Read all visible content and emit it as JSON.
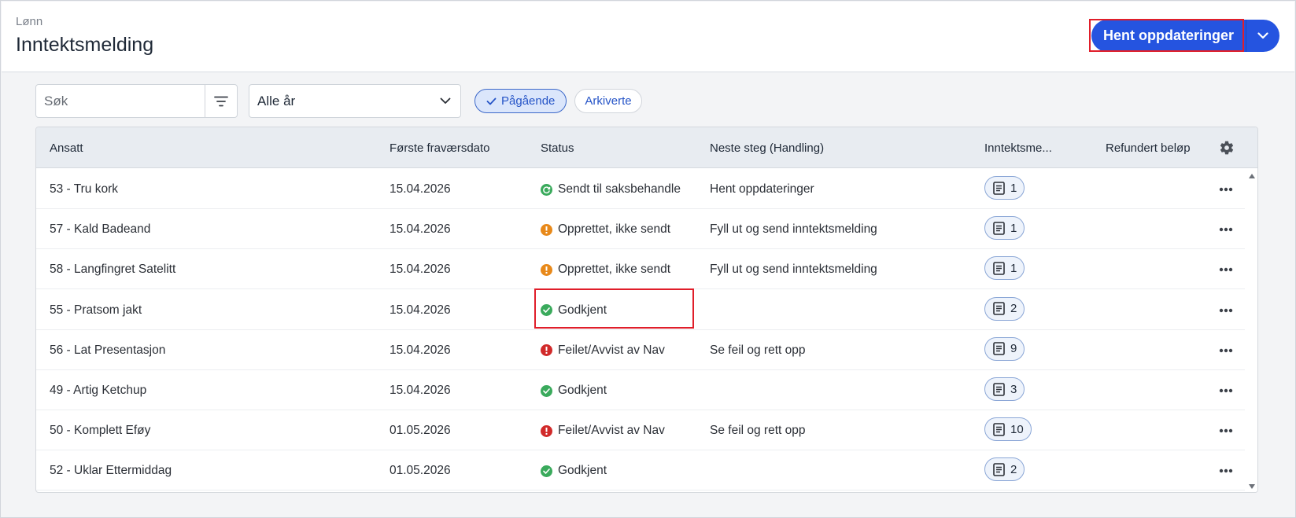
{
  "header": {
    "breadcrumb": "Lønn",
    "title": "Inntektsmelding",
    "primary_action": "Hent oppdateringer",
    "accent_color": "#2554e0"
  },
  "toolbar": {
    "search_placeholder": "Søk",
    "year_select_value": "Alle år",
    "chips": [
      {
        "label": "Pågående",
        "active": true
      },
      {
        "label": "Arkiverte",
        "active": false
      }
    ]
  },
  "table": {
    "columns": {
      "employee": "Ansatt",
      "first_absence": "Første fraværsdato",
      "status": "Status",
      "next_step": "Neste steg (Handling)",
      "reports": "Inntektsme...",
      "refund": "Refundert beløp"
    },
    "rows": [
      {
        "employee": "53 - Tru kork",
        "date": "15.04.2026",
        "status": "Sendt til saksbehandle",
        "status_type": "sent",
        "next": "Hent oppdateringer",
        "count": "1"
      },
      {
        "employee": "57 - Kald Badeand",
        "date": "15.04.2026",
        "status": "Opprettet, ikke sendt",
        "status_type": "warning",
        "next": "Fyll ut og send inntektsmelding",
        "count": "1"
      },
      {
        "employee": "58 - Langfingret Satelitt",
        "date": "15.04.2026",
        "status": "Opprettet, ikke sendt",
        "status_type": "warning",
        "next": "Fyll ut og send inntektsmelding",
        "count": "1"
      },
      {
        "employee": "55 - Pratsom jakt",
        "date": "15.04.2026",
        "status": "Godkjent",
        "status_type": "success",
        "next": "",
        "count": "2"
      },
      {
        "employee": "56 - Lat Presentasjon",
        "date": "15.04.2026",
        "status": "Feilet/Avvist av Nav",
        "status_type": "error",
        "next": "Se feil og rett opp",
        "count": "9"
      },
      {
        "employee": "49 - Artig Ketchup",
        "date": "15.04.2026",
        "status": "Godkjent",
        "status_type": "success",
        "next": "",
        "count": "3"
      },
      {
        "employee": "50 - Komplett Eføy",
        "date": "01.05.2026",
        "status": "Feilet/Avvist av Nav",
        "status_type": "error",
        "next": "Se feil og rett opp",
        "count": "10"
      },
      {
        "employee": "52 - Uklar Ettermiddag",
        "date": "01.05.2026",
        "status": "Godkjent",
        "status_type": "success",
        "next": "",
        "count": "2"
      }
    ]
  },
  "status_colors": {
    "success": "#3aaa5c",
    "sent": "#3aaa5c",
    "warning": "#e8891a",
    "error": "#d12a2a"
  },
  "icons": {
    "filter": "filter-icon",
    "dropdown": "chevron-down-icon",
    "check": "check-icon",
    "settings": "gear-icon",
    "document": "document-icon",
    "more": "more-horizontal-icon"
  }
}
